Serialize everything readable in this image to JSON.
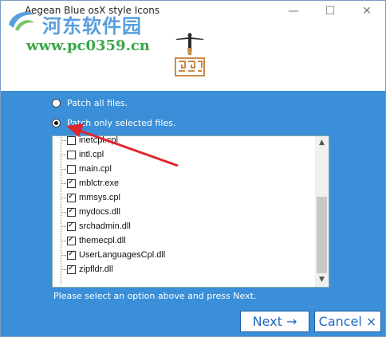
{
  "window": {
    "title": "Aegean Blue osX style Icons",
    "controls": {
      "minimize": "—",
      "maximize": "☐",
      "close": "✕"
    }
  },
  "watermark": {
    "site_name_cn": "河东软件园",
    "url": "www.pc0359.cn"
  },
  "options": {
    "patch_all_label": "Patch all files.",
    "patch_selected_label": "Patch only selected files.",
    "selected": "patch_selected"
  },
  "files": [
    {
      "name": "inetcpl.cpl",
      "checked": false
    },
    {
      "name": "intl.cpl",
      "checked": false
    },
    {
      "name": "main.cpl",
      "checked": false
    },
    {
      "name": "mblctr.exe",
      "checked": true
    },
    {
      "name": "mmsys.cpl",
      "checked": true
    },
    {
      "name": "mydocs.dll",
      "checked": true
    },
    {
      "name": "srchadmin.dll",
      "checked": true
    },
    {
      "name": "themecpl.dll",
      "checked": true
    },
    {
      "name": "UserLanguagesCpl.dll",
      "checked": true
    },
    {
      "name": "zipfldr.dll",
      "checked": true
    }
  ],
  "scrollbar": {
    "up_icon": "▲",
    "down_icon": "▼"
  },
  "hint": "Please select an option above and press Next.",
  "buttons": {
    "next": "Next →",
    "cancel": "Cancel ×"
  },
  "colors": {
    "panel": "#3a8fd8",
    "arrow": "#e0242c",
    "button_text": "#1f68c0"
  }
}
